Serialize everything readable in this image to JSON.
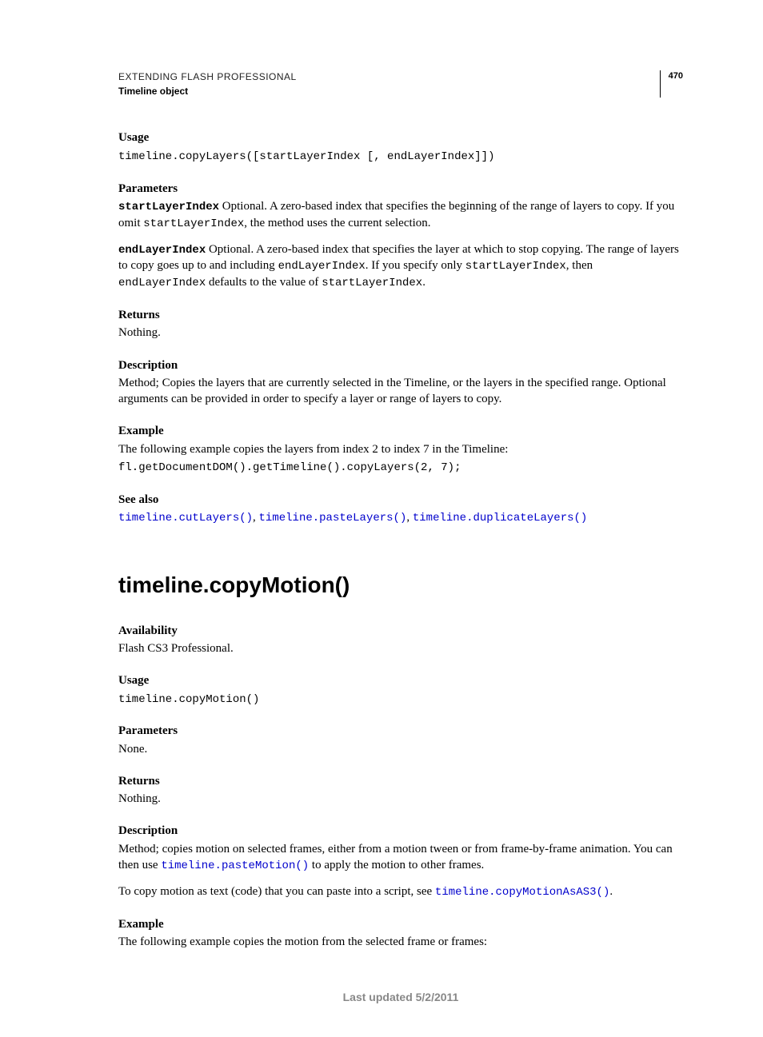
{
  "header": {
    "title": "EXTENDING FLASH PROFESSIONAL",
    "sub": "Timeline object",
    "page": "470"
  },
  "s1": {
    "usage_h": "Usage",
    "usage_c": "timeline.copyLayers([startLayerIndex [, endLayerIndex]])",
    "params_h": "Parameters",
    "p1_name": "startLayerIndex",
    "p1_t1": "  Optional. A zero-based index that specifies the beginning of the range of layers to copy. If you omit ",
    "p1_c": "startLayerIndex",
    "p1_t2": ", the method uses the current selection.",
    "p2_name": "endLayerIndex",
    "p2_t1": "  Optional. A zero-based index that specifies the layer at which to stop copying. The range of layers to copy goes up to and including ",
    "p2_c1": "endLayerIndex",
    "p2_t2": ". If you specify only ",
    "p2_c2": "startLayerIndex",
    "p2_t3": ", then ",
    "p2_c3": "endLayerIndex",
    "p2_t4": " defaults to the value of ",
    "p2_c4": "startLayerIndex",
    "p2_t5": ".",
    "returns_h": "Returns",
    "returns_t": "Nothing.",
    "desc_h": "Description",
    "desc_t": "Method; Copies the layers that are currently selected in the Timeline, or the layers in the specified range. Optional arguments can be provided in order to specify a layer or range of layers to copy.",
    "ex_h": "Example",
    "ex_t": "The following example copies the layers from index 2 to index 7 in the Timeline:",
    "ex_c": "fl.getDocumentDOM().getTimeline().copyLayers(2, 7);",
    "see_h": "See also",
    "see_l1": "timeline.cutLayers()",
    "see_s1": ", ",
    "see_l2": "timeline.pasteLayers()",
    "see_s2": ", ",
    "see_l3": "timeline.duplicateLayers()"
  },
  "s2": {
    "title": "timeline.copyMotion()",
    "avail_h": "Availability",
    "avail_t": "Flash CS3 Professional.",
    "usage_h": "Usage",
    "usage_c": "timeline.copyMotion()",
    "params_h": "Parameters",
    "params_t": "None.",
    "returns_h": "Returns",
    "returns_t": "Nothing.",
    "desc_h": "Description",
    "desc_t1": "Method; copies motion on selected frames, either from a motion tween or from frame-by-frame animation. You can then use ",
    "desc_l1": "timeline.pasteMotion()",
    "desc_t2": " to apply the motion to other frames.",
    "desc_t3": "To copy motion as text (code) that you can paste into a script, see ",
    "desc_l2": "timeline.copyMotionAsAS3()",
    "desc_t4": ".",
    "ex_h": "Example",
    "ex_t": "The following example copies the motion from the selected frame or frames:"
  },
  "footer": "Last updated 5/2/2011"
}
